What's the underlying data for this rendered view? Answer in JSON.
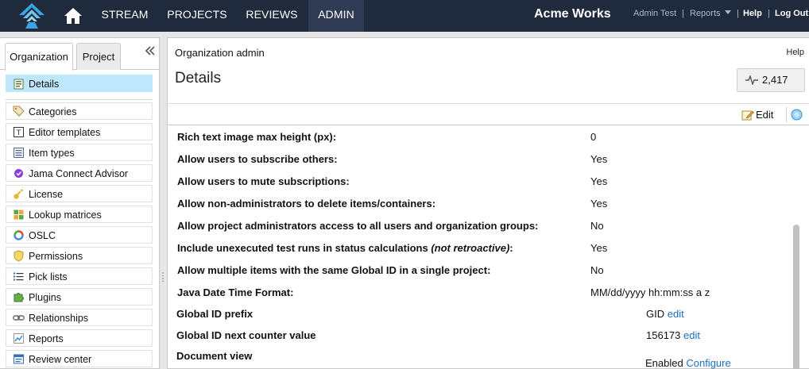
{
  "nav": {
    "items": [
      "STREAM",
      "PROJECTS",
      "REVIEWS",
      "ADMIN"
    ],
    "active": "ADMIN",
    "brand": "Acme Works",
    "user": "Admin Test",
    "reports": "Reports",
    "help": "Help",
    "logout": "Log Out",
    "separator": "|"
  },
  "sidebar": {
    "tabs": [
      "Organization",
      "Project"
    ],
    "active_tab": "Organization",
    "selected": "Details",
    "items": [
      {
        "label": "Details",
        "icon": "details-icon"
      },
      {
        "label": "Categories",
        "icon": "tag-icon"
      },
      {
        "label": "Editor templates",
        "icon": "template-icon"
      },
      {
        "label": "Item types",
        "icon": "item-types-icon"
      },
      {
        "label": "Jama Connect Advisor",
        "icon": "advisor-badge-icon"
      },
      {
        "label": "License",
        "icon": "key-icon"
      },
      {
        "label": "Lookup matrices",
        "icon": "matrix-icon"
      },
      {
        "label": "OSLC",
        "icon": "oslc-ring-icon"
      },
      {
        "label": "Permissions",
        "icon": "shield-icon"
      },
      {
        "label": "Pick lists",
        "icon": "list-icon"
      },
      {
        "label": "Plugins",
        "icon": "puzzle-icon"
      },
      {
        "label": "Relationships",
        "icon": "link-icon"
      },
      {
        "label": "Reports",
        "icon": "chart-icon"
      },
      {
        "label": "Review center",
        "icon": "review-icon"
      }
    ]
  },
  "main": {
    "breadcrumb": "Organization admin",
    "help": "Help",
    "title": "Details",
    "counter": "2,417",
    "edit_label": "Edit",
    "rows": [
      {
        "label": "Rich text image max height (px):",
        "value": "0"
      },
      {
        "label": "Allow users to subscribe others:",
        "value": "Yes"
      },
      {
        "label": "Allow users to mute subscriptions:",
        "value": "Yes"
      },
      {
        "label": "Allow non-administrators to delete items/containers:",
        "value": "Yes"
      },
      {
        "label": "Allow project administrators access to all users and organization groups:",
        "value": "No"
      },
      {
        "label": "Include unexecuted test runs in status calculations ",
        "note": "(not retroactive)",
        "suffix": ":",
        "value": "Yes"
      },
      {
        "label": "Allow multiple items with the same Global ID in a single project:",
        "value": "No"
      },
      {
        "label": "Java Date Time Format:",
        "value": "MM/dd/yyyy hh:mm:ss a z"
      }
    ],
    "settings": [
      {
        "label": "Global ID prefix",
        "value": "GID",
        "link": "edit"
      },
      {
        "label": "Global ID next counter value",
        "value": "156173",
        "link": "edit"
      },
      {
        "label": "Document view",
        "value": "Enabled",
        "link": "Configure"
      }
    ]
  },
  "colors": {
    "nav_bg": "#1f2a3c",
    "nav_active": "#2e3b52",
    "selected_row": "#bfe7fb",
    "link": "#1a6fc2"
  }
}
